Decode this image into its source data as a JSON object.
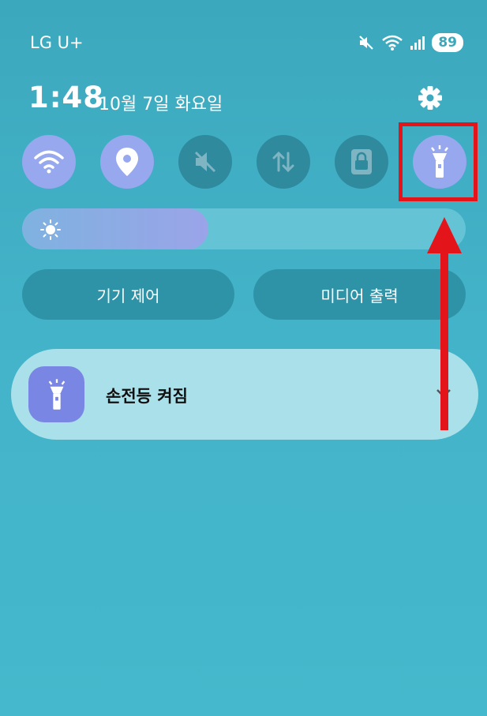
{
  "status_bar": {
    "carrier": "LG U+",
    "battery": "89",
    "icons": [
      "mute-icon",
      "wifi-icon",
      "signal-icon"
    ]
  },
  "header": {
    "time": "1:48",
    "date": "10월 7일 화요일"
  },
  "quick_tiles": [
    {
      "name": "wifi",
      "icon": "wifi-icon",
      "state": "on"
    },
    {
      "name": "location",
      "icon": "location-icon",
      "state": "on"
    },
    {
      "name": "sound",
      "icon": "mute-icon",
      "state": "off"
    },
    {
      "name": "data",
      "icon": "data-transfer-icon",
      "state": "off"
    },
    {
      "name": "lock",
      "icon": "lock-icon",
      "state": "off"
    },
    {
      "name": "flashlight",
      "icon": "flashlight-icon",
      "state": "on"
    }
  ],
  "brightness": {
    "level": 0.42
  },
  "buttons": {
    "device_control": "기기 제어",
    "media_output": "미디어 출력"
  },
  "notification": {
    "text": "손전등 켜짐",
    "icon": "flashlight-icon"
  },
  "colors": {
    "background": "#43b3c9",
    "tile_on": "#97a8ee",
    "tile_off": "#2f8a9e",
    "highlight": "#e4141b"
  }
}
